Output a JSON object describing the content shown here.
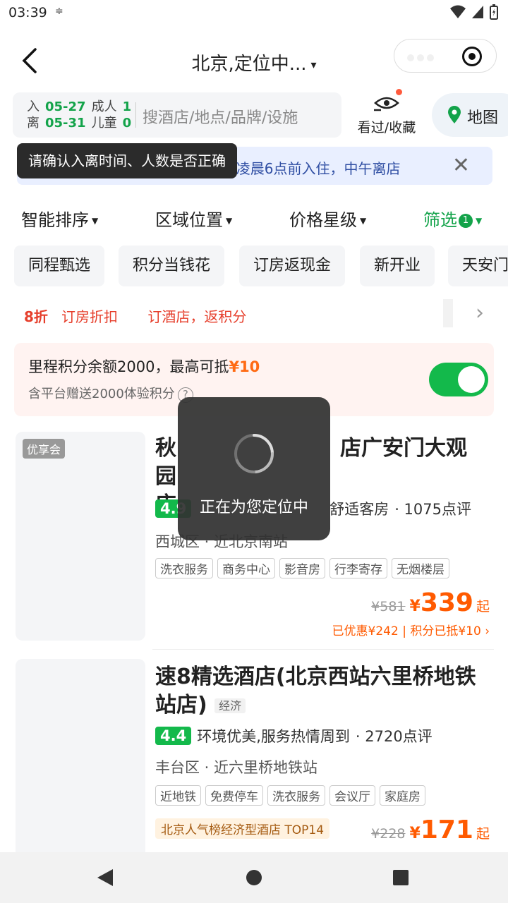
{
  "status": {
    "time": "03:39",
    "dots_icon": "data-saver-icon"
  },
  "header": {
    "title": "北京,定位中...",
    "caret": "▾"
  },
  "search": {
    "checkin_label": "入",
    "checkin_date": "05-27",
    "checkout_label": "离",
    "checkout_date": "05-31",
    "adult_label": "成人",
    "adult_count": "1",
    "child_label": "儿童",
    "child_count": "0",
    "placeholder": "搜酒店/地点/品牌/设施"
  },
  "viewed_label": "看过/收藏",
  "map_label": "地图",
  "notice": {
    "text": "当前已过0点，您需要在今天凌晨6点前入住，中午离店"
  },
  "tooltip": "请确认入离时间、人数是否正确",
  "filters": [
    {
      "label": "智能排序"
    },
    {
      "label": "区域位置"
    },
    {
      "label": "价格星级"
    },
    {
      "label": "筛选",
      "badge": "1"
    }
  ],
  "chips": [
    "同程甄选",
    "积分当钱花",
    "订房返现金",
    "新开业",
    "天安门"
  ],
  "promo": {
    "p1": "8折",
    "p2": "订房折扣",
    "p3": "订酒店，返积分"
  },
  "points": {
    "line1": "里程积分余额2000，最高可抵",
    "line1_amount": "¥10",
    "line2": "含平台赠送2000体验积分",
    "help": "?"
  },
  "hotels": [
    {
      "img_tag": "优享会",
      "name_left": "秋",
      "name_right": "店广安门大观园",
      "name_line2": "店",
      "score": "4.9",
      "review_text": "舒适客房",
      "reviews": "· 1075点评",
      "location": "西城区 · 近北京南站",
      "amenities": [
        "洗衣服务",
        "商务中心",
        "影音房",
        "行李寄存",
        "无烟楼层"
      ],
      "old_price": "¥581",
      "yen": "¥",
      "price": "339",
      "qi": "起",
      "discount": "已优惠¥242 | 积分已抵¥10 ›"
    },
    {
      "name": "速8精选酒店(北京西站六里桥地铁站店)",
      "name_l1": "速8精选酒店(北京西站六里桥地铁",
      "name_l2": "站店)",
      "category": "经济",
      "score": "4.4",
      "review_text": "环境优美,服务热情周到",
      "reviews": "· 2720点评",
      "location": "丰台区 · 近六里桥地铁站",
      "amenities": [
        "近地铁",
        "免费停车",
        "洗衣服务",
        "会议厅",
        "家庭房"
      ],
      "rank": "北京人气榜经济型酒店 TOP14",
      "old_price": "¥228",
      "yen": "¥",
      "price": "171",
      "qi": "起"
    }
  ],
  "toast": "正在为您定位中",
  "colors": {
    "green": "#13a34a",
    "orange": "#ff5a00",
    "red": "#e63e2b"
  }
}
